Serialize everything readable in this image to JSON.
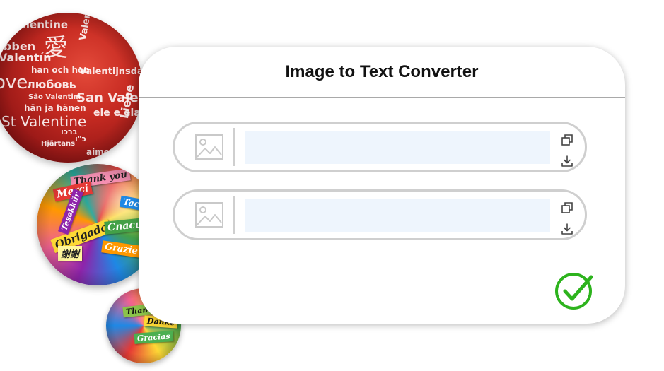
{
  "card": {
    "title": "Image to Text Converter"
  },
  "rows": [
    {
      "image_icon": "image-placeholder-icon",
      "text_value": "",
      "copy_icon": "copy-icon",
      "download_icon": "download-icon"
    },
    {
      "image_icon": "image-placeholder-icon",
      "text_value": "",
      "copy_icon": "copy-icon",
      "download_icon": "download-icon"
    }
  ],
  "confirm": {
    "icon": "check-circle-icon",
    "color": "#2db31d"
  },
  "colors": {
    "row_border": "#cfcfcf",
    "text_area_bg": "#eef5fd",
    "divider": "#a9a9a9"
  },
  "decor": {
    "red_sphere_words": [
      "Valentine",
      "愛",
      "Valentine",
      "Valentín",
      "Ebben",
      "han och hon",
      "Valentijnsdag",
      "любовь",
      "ove",
      "São Valentim",
      "San Valentin",
      "hän ja hänen",
      "St Valentine",
      "ele e ela",
      "Liebe",
      "Hjärtans",
      "aimer",
      "כ\"ו",
      "ברכו"
    ],
    "multi_sphere_tags": [
      "Thank you",
      "Merci",
      "Obrigado",
      "Спасибо",
      "Tack",
      "謝謝",
      "Grazie",
      "Teşekkür"
    ],
    "small_sphere_tags": [
      "Thank",
      "Danke",
      "Gracias"
    ]
  }
}
